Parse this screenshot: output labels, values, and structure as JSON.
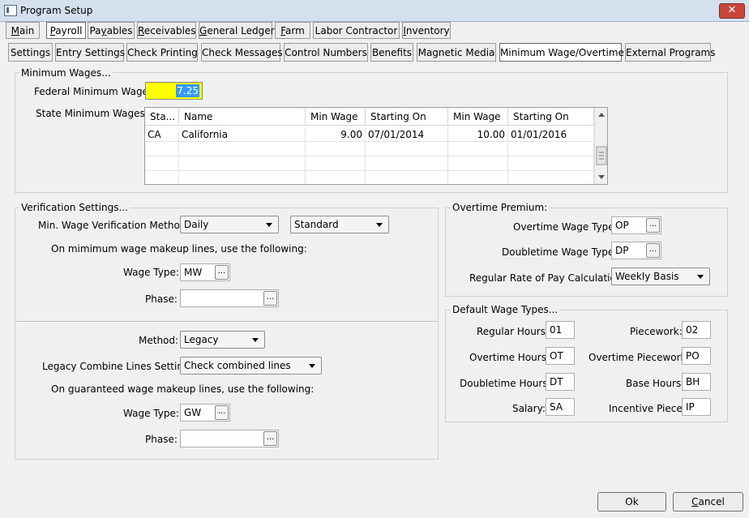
{
  "window": {
    "title": "Program Setup",
    "close_glyph": "✕"
  },
  "top_tabs": [
    {
      "pre": "",
      "key": "M",
      "post": "ain"
    },
    {
      "pre": "",
      "key": "P",
      "post": "ayroll"
    },
    {
      "pre": "Pa",
      "key": "y",
      "post": "ables"
    },
    {
      "pre": "",
      "key": "R",
      "post": "eceivables"
    },
    {
      "pre": "",
      "key": "G",
      "post": "eneral Ledger"
    },
    {
      "pre": "",
      "key": "F",
      "post": "arm"
    },
    {
      "pre": "",
      "key": "",
      "post": "Labor Contractor"
    },
    {
      "pre": "",
      "key": "I",
      "post": "nventory"
    }
  ],
  "sub_tabs": [
    "Settings",
    "Entry Settings",
    "Check Printing",
    "Check Messages",
    "Control Numbers",
    "Benefits",
    "Magnetic Media",
    "Minimum Wage/Overtime",
    "External Programs"
  ],
  "minimum_wages": {
    "group_title": "Minimum Wages...",
    "federal_label": "Federal Minimum Wage:",
    "federal_value": "7.25",
    "state_label": "State Minimum Wages:",
    "columns": [
      "Sta...",
      "Name",
      "Min Wage",
      "Starting On",
      "Min Wage",
      "Starting On"
    ],
    "rows": [
      {
        "state": "CA",
        "name": "California",
        "min_wage1": "9.00",
        "start1": "07/01/2014",
        "min_wage2": "10.00",
        "start2": "01/01/2016"
      }
    ]
  },
  "verification": {
    "group_title": "Verification Settings...",
    "method_label": "Min. Wage Verification Method:",
    "method_value": "Daily",
    "method_value2": "Standard",
    "makeup_note": "On mimimum wage makeup lines, use the following:",
    "wage_type_label": "Wage Type:",
    "wage_type_value": "MW",
    "phase_label": "Phase:",
    "phase_value": "",
    "method2_label": "Method:",
    "method2_value": "Legacy",
    "legacy_label": "Legacy Combine Lines Setting:",
    "legacy_value": "Check combined lines",
    "guaranteed_note": "On guaranteed wage makeup lines, use the following:",
    "wage_type2_label": "Wage Type:",
    "wage_type2_value": "GW",
    "phase2_label": "Phase:",
    "phase2_value": "",
    "ellipsis": "..."
  },
  "overtime": {
    "group_title": "Overtime Premium:",
    "ot_label": "Overtime Wage Type:",
    "ot_value": "OP",
    "dt_label": "Doubletime Wage Type:",
    "dt_value": "DP",
    "rate_label": "Regular Rate of Pay Calculation:",
    "rate_value": "Weekly Basis"
  },
  "default_wage": {
    "group_title": "Default Wage Types...",
    "regular_label": "Regular Hours:",
    "regular_value": "01",
    "overtime_label": "Overtime Hours:",
    "overtime_value": "OT",
    "doubletime_label": "Doubletime Hours:",
    "doubletime_value": "DT",
    "salary_label": "Salary:",
    "salary_value": "SA",
    "piecework_label": "Piecework:",
    "piecework_value": "02",
    "ot_piecework_label": "Overtime Piecework:",
    "ot_piecework_value": "PO",
    "base_label": "Base Hours:",
    "base_value": "BH",
    "incentive_label": "Incentive Piece:",
    "incentive_value": "IP"
  },
  "buttons": {
    "ok": "Ok",
    "cancel_pre": "",
    "cancel_key": "C",
    "cancel_post": "ancel"
  },
  "colors": {
    "highlight": "#ffff00",
    "selection": "#3399ff"
  }
}
